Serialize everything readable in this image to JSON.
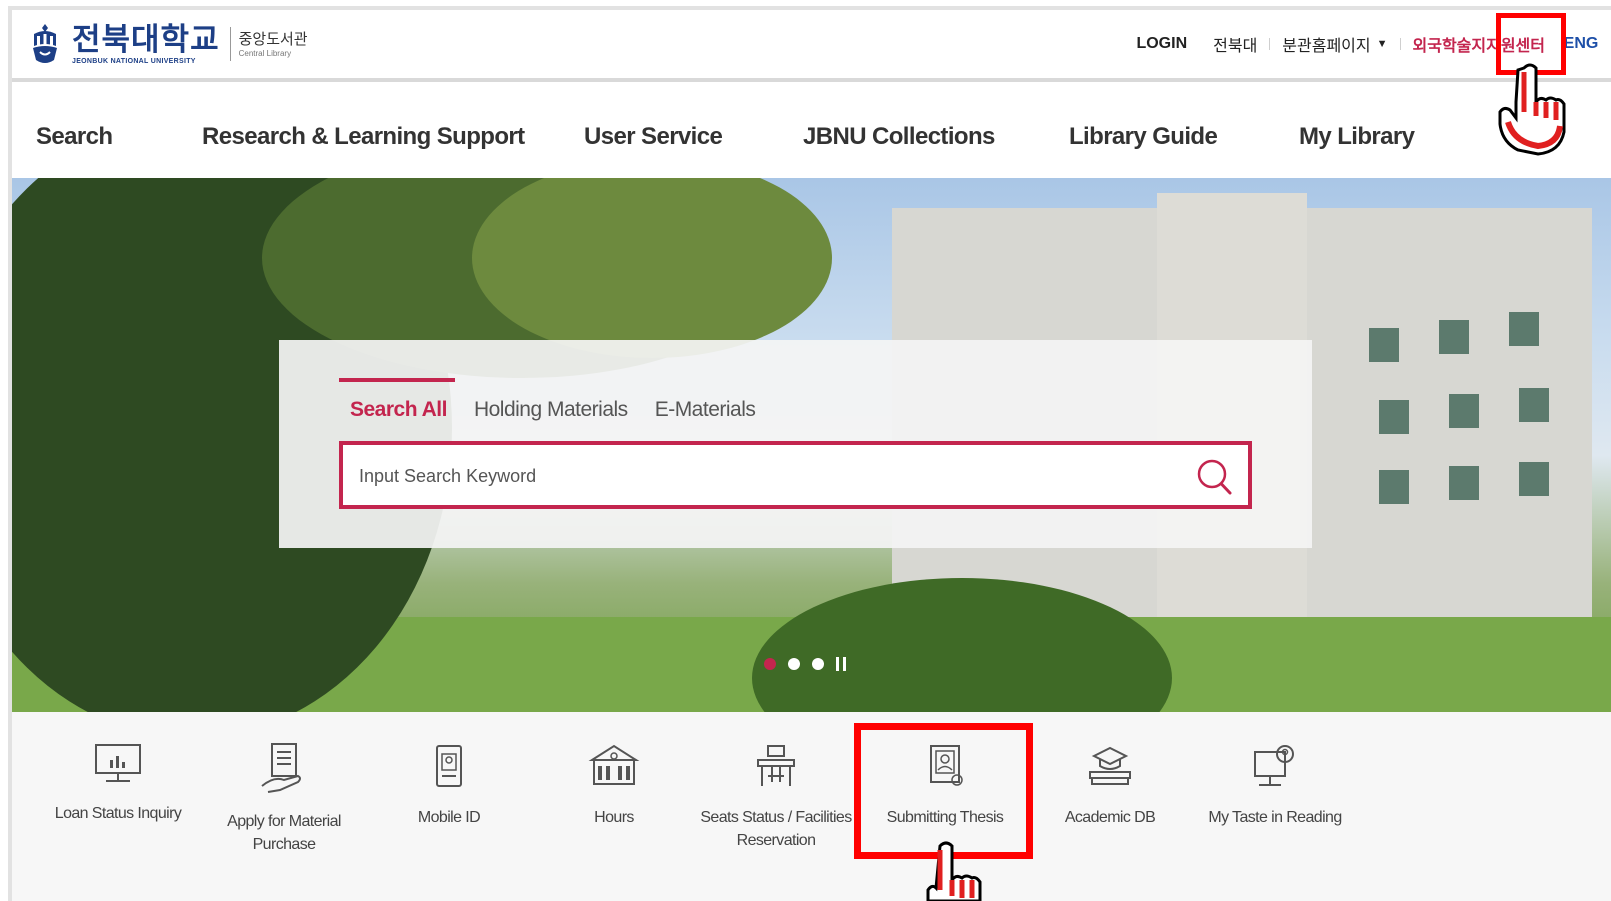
{
  "header": {
    "university_ko": "전북대학교",
    "university_en": "JEONBUK NATIONAL UNIVERSITY",
    "library_ko": "중앙도서관",
    "library_en": "Central Library",
    "util": {
      "login": "LOGIN",
      "jbnu": "전북대",
      "branch": "분관홈페이지",
      "intl_center": "외국학술지지원센터",
      "eng": "ENG"
    }
  },
  "nav": {
    "items": [
      "Search",
      "Research & Learning Support",
      "User Service",
      "JBNU Collections",
      "Library Guide",
      "My Library"
    ]
  },
  "search": {
    "tabs": [
      "Search All",
      "Holding Materials",
      "E-Materials"
    ],
    "active_tab": "Search All",
    "placeholder": "Input Search Keyword",
    "value": ""
  },
  "slider": {
    "dots": 3,
    "active": 1
  },
  "quick_menu": [
    {
      "icon": "monitor-chart-icon",
      "label": "Loan Status Inquiry"
    },
    {
      "icon": "hand-document-icon",
      "label": "Apply for Material Purchase"
    },
    {
      "icon": "mobile-id-icon",
      "label": "Mobile ID"
    },
    {
      "icon": "building-icon",
      "label": "Hours"
    },
    {
      "icon": "desk-chair-icon",
      "label": "Seats Status / Facilities Reservation"
    },
    {
      "icon": "thesis-document-icon",
      "label": "Submitting Thesis"
    },
    {
      "icon": "graduation-books-icon",
      "label": "Academic DB"
    },
    {
      "icon": "person-screen-icon",
      "label": "My Taste in Reading"
    }
  ],
  "colors": {
    "brand_blue": "#1d3f86",
    "accent_magenta": "#c3254e",
    "highlight_red": "#ff0000"
  }
}
